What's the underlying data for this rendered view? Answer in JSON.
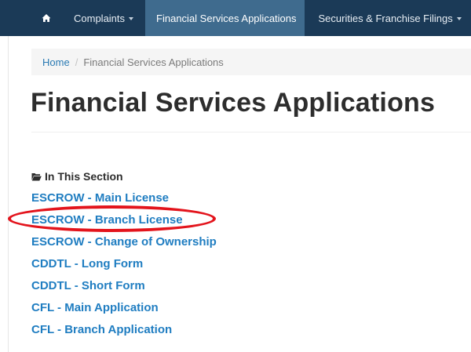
{
  "nav": {
    "complaints": "Complaints",
    "financial_services": "Financial Services Applications",
    "securities": "Securities & Franchise Filings"
  },
  "breadcrumb": {
    "home": "Home",
    "separator": "/",
    "current": "Financial Services Applications"
  },
  "page_title": "Financial Services Applications",
  "section": {
    "heading": "In This Section",
    "icon": "folder-open-icon",
    "links": [
      "ESCROW - Main License",
      "ESCROW - Branch License",
      "ESCROW - Change of Ownership",
      "CDDTL - Long Form",
      "CDDTL - Short Form",
      "CFL - Main Application",
      "CFL - Branch Application"
    ]
  },
  "colors": {
    "navbar": "#1b3a57",
    "nav_active": "#3f6b8e",
    "link": "#1f7dc1",
    "annotation": "#e3141c"
  }
}
